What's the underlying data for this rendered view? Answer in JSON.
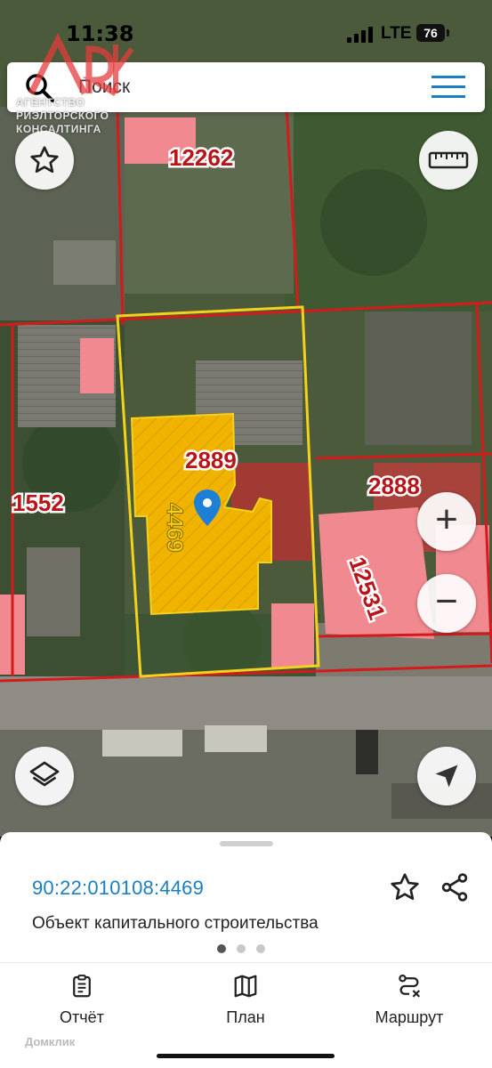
{
  "status": {
    "time": "11:38",
    "network": "LTE",
    "battery": "76"
  },
  "search": {
    "placeholder": "Поиск",
    "icon": "search-icon",
    "menu_icon": "hamburger-icon"
  },
  "watermark": {
    "logo": "ARK",
    "line1": "АГЕНТСТВО",
    "line2": "РИЭЛТОРСКОГО",
    "line3": "КОНСАЛТИНГА"
  },
  "map": {
    "parcel_labels": [
      "12262",
      "2889",
      "1552",
      "2888",
      "12531",
      "4469"
    ],
    "selected_parcel": "4469",
    "colors": {
      "boundary": "#d41a1a",
      "selected_boundary": "#f2d21c",
      "building_fill": "#f0b400",
      "neighbor_fill": "#f08a90"
    }
  },
  "controls": {
    "favorite_icon": "star-icon",
    "ruler_icon": "ruler-icon",
    "zoom_in": "+",
    "zoom_out": "−",
    "layers_icon": "layers-icon",
    "locate_icon": "navigation-arrow-icon"
  },
  "sheet": {
    "cadastral_number": "90:22:010108:4469",
    "object_type": "Объект капитального строительства",
    "page_count": 3,
    "active_page": 1,
    "accent": "#1a7fc1"
  },
  "tabs": [
    {
      "label": "Отчёт",
      "icon": "report-clipboard-icon"
    },
    {
      "label": "План",
      "icon": "map-plan-icon"
    },
    {
      "label": "Маршрут",
      "icon": "route-icon"
    }
  ],
  "footer": {
    "brand": "Домклик"
  }
}
